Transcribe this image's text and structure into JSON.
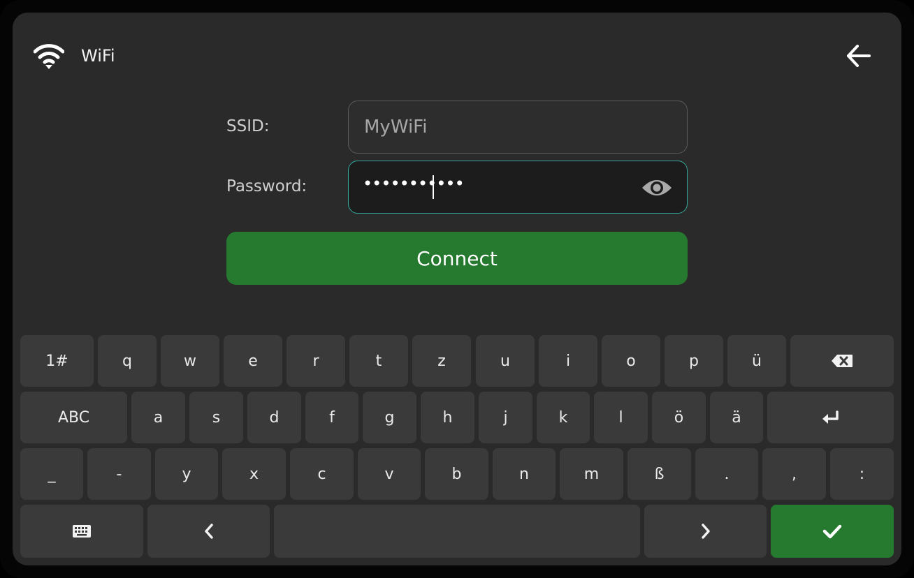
{
  "header": {
    "title": "WiFi",
    "back_icon": "arrow-left-icon",
    "wifi_icon": "wifi-icon"
  },
  "form": {
    "ssid_label": "SSID:",
    "ssid_value": "MyWiFi",
    "password_label": "Password:",
    "password_value": "•••••••••••",
    "show_password_icon": "eye-icon",
    "connect_label": "Connect"
  },
  "keyboard": {
    "row1": [
      "1#",
      "q",
      "w",
      "e",
      "r",
      "t",
      "z",
      "u",
      "i",
      "o",
      "p",
      "ü"
    ],
    "row2": [
      "ABC",
      "a",
      "s",
      "d",
      "f",
      "g",
      "h",
      "j",
      "k",
      "l",
      "ö",
      "ä"
    ],
    "row3": [
      "_",
      "-",
      "y",
      "x",
      "c",
      "v",
      "b",
      "n",
      "m",
      "ß",
      ".",
      ",",
      ":"
    ],
    "icons": {
      "backspace": "backspace-icon",
      "enter": "enter-icon",
      "keyboard": "keyboard-icon",
      "left": "chevron-left-icon",
      "right": "chevron-right-icon",
      "confirm": "checkmark-icon"
    }
  },
  "colors": {
    "background": "#2a2a2a",
    "key": "#3a3a3a",
    "accent_green": "#267a2f",
    "focus_border": "#33a89a"
  }
}
